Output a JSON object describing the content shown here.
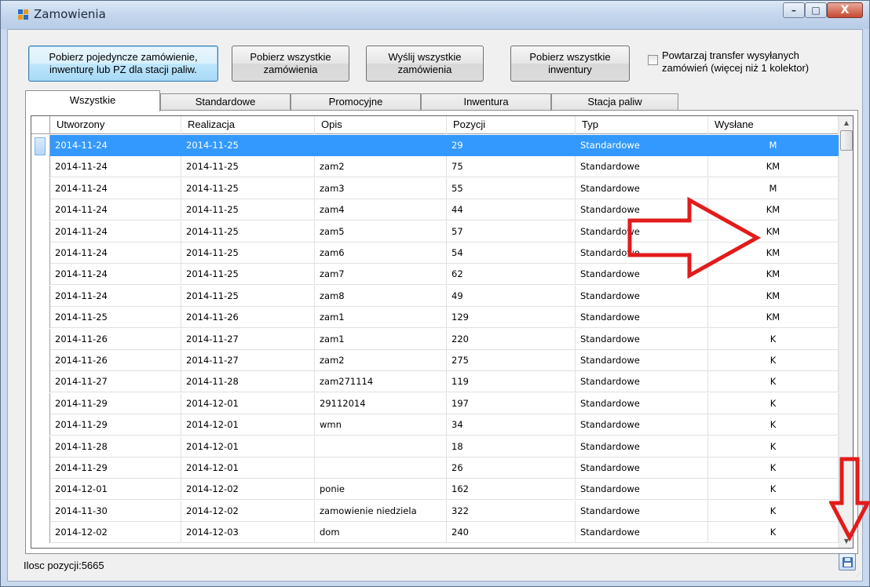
{
  "window": {
    "title": "Zamowienia",
    "controls": {
      "minimize": "–",
      "maximize": "□",
      "close": "X"
    }
  },
  "toolbar": {
    "btn_single": "Pobierz pojedyncze zamówienie,\ninwenturę lub PZ dla stacji paliw.",
    "btn_all_orders": "Pobierz wszystkie\nzamówienia",
    "btn_send_all": "Wyślij wszystkie\nzamówienia",
    "btn_all_inventories": "Pobierz wszystkie\ninwentury",
    "repeat_checkbox_label": "Powtarzaj transfer wysyłanych\nzamówień (więcej niż 1 kolektor)",
    "repeat_checked": false
  },
  "tabs": [
    {
      "label": "Wszystkie",
      "active": true
    },
    {
      "label": "Standardowe",
      "active": false
    },
    {
      "label": "Promocyjne",
      "active": false
    },
    {
      "label": "Inwentura",
      "active": false
    },
    {
      "label": "Stacja paliw",
      "active": false
    }
  ],
  "table": {
    "columns": [
      "Utworzony",
      "Realizacja",
      "Opis",
      "Pozycji",
      "Typ",
      "Wysłane"
    ],
    "rows": [
      [
        "2014-11-24",
        "2014-11-25",
        "",
        "29",
        "Standardowe",
        "M"
      ],
      [
        "2014-11-24",
        "2014-11-25",
        "zam2",
        "75",
        "Standardowe",
        "KM"
      ],
      [
        "2014-11-24",
        "2014-11-25",
        "zam3",
        "55",
        "Standardowe",
        "M"
      ],
      [
        "2014-11-24",
        "2014-11-25",
        "zam4",
        "44",
        "Standardowe",
        "KM"
      ],
      [
        "2014-11-24",
        "2014-11-25",
        "zam5",
        "57",
        "Standardowe",
        "KM"
      ],
      [
        "2014-11-24",
        "2014-11-25",
        "zam6",
        "54",
        "Standardowe",
        "KM"
      ],
      [
        "2014-11-24",
        "2014-11-25",
        "zam7",
        "62",
        "Standardowe",
        "KM"
      ],
      [
        "2014-11-24",
        "2014-11-25",
        "zam8",
        "49",
        "Standardowe",
        "KM"
      ],
      [
        "2014-11-25",
        "2014-11-26",
        "zam1",
        "129",
        "Standardowe",
        "KM"
      ],
      [
        "2014-11-26",
        "2014-11-27",
        "zam1",
        "220",
        "Standardowe",
        "K"
      ],
      [
        "2014-11-26",
        "2014-11-27",
        "zam2",
        "275",
        "Standardowe",
        "K"
      ],
      [
        "2014-11-27",
        "2014-11-28",
        "zam271114",
        "119",
        "Standardowe",
        "K"
      ],
      [
        "2014-11-29",
        "2014-12-01",
        "29112014",
        "197",
        "Standardowe",
        "K"
      ],
      [
        "2014-11-29",
        "2014-12-01",
        "wmn",
        "34",
        "Standardowe",
        "K"
      ],
      [
        "2014-11-28",
        "2014-12-01",
        "",
        "18",
        "Standardowe",
        "K"
      ],
      [
        "2014-11-29",
        "2014-12-01",
        "",
        "26",
        "Standardowe",
        "K"
      ],
      [
        "2014-12-01",
        "2014-12-02",
        "ponie",
        "162",
        "Standardowe",
        "K"
      ],
      [
        "2014-11-30",
        "2014-12-02",
        "zamowienie niedziela",
        "322",
        "Standardowe",
        "K"
      ],
      [
        "2014-12-02",
        "2014-12-03",
        "dom",
        "240",
        "Standardowe",
        "K"
      ]
    ],
    "selected_row": 0
  },
  "status": {
    "count_label": "Ilosc pozycji:5665"
  },
  "colors": {
    "selection": "#3399ff",
    "annotation_arrow": "#e21b1b"
  },
  "icons": {
    "app": "app-grid-icon",
    "save": "save-disk-icon"
  }
}
